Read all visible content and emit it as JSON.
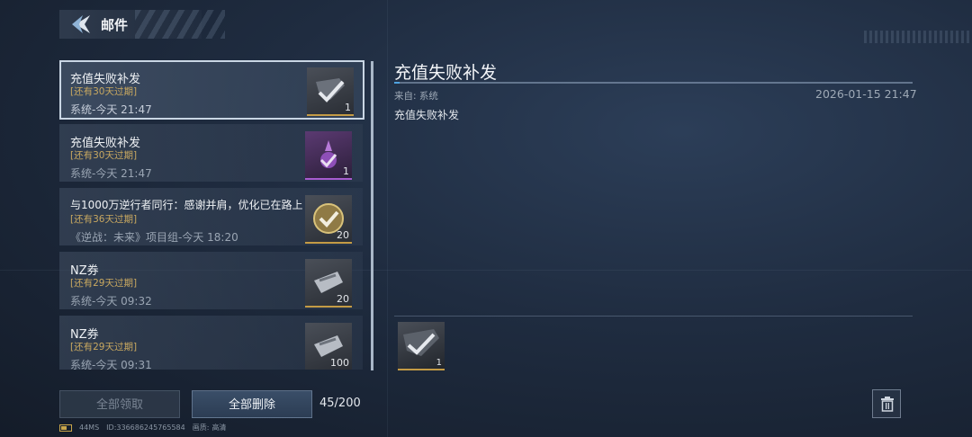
{
  "header": {
    "title": "邮件",
    "back_icon": "back-arrow-icon"
  },
  "mail_list": {
    "items": [
      {
        "subject": "充值失败补发",
        "expire": "[还有30天过期]",
        "sender": "系统-今天 21:47",
        "count": "1",
        "icon": "weapon-icon",
        "selected": true
      },
      {
        "subject": "充值失败补发",
        "expire": "[还有30天过期]",
        "sender": "系统-今天 21:47",
        "count": "1",
        "icon": "purple-item-icon",
        "selected": false
      },
      {
        "subject": "与1000万逆行者同行：感谢并肩，优化已在路上",
        "expire": "[还有36天过期]",
        "sender": "《逆战：未来》项目组-今天 18:20",
        "count": "20",
        "icon": "coin-icon",
        "selected": false
      },
      {
        "subject": "NZ券",
        "expire": "[还有29天过期]",
        "sender": "系统-今天 09:32",
        "count": "20",
        "icon": "ticket-icon",
        "selected": false
      },
      {
        "subject": "NZ券",
        "expire": "[还有29天过期]",
        "sender": "系统-今天 09:31",
        "count": "100",
        "icon": "ticket-icon",
        "selected": false
      }
    ]
  },
  "detail": {
    "title": "充值失败补发",
    "from": "来自: 系统",
    "date": "2026-01-15 21:47",
    "body": "充值失败补发",
    "attachment": {
      "count": "1",
      "icon": "weapon-icon"
    }
  },
  "footer": {
    "claim_all": "全部领取",
    "delete_all": "全部删除",
    "mail_count": "45/200",
    "trash_icon": "trash-icon"
  },
  "status": {
    "ping": "44MS",
    "id": "ID:336686245765584",
    "quality_label": "画质:",
    "quality": "高清"
  },
  "colors": {
    "expire": "#c8a860",
    "accent": "#4fa3e0",
    "rarity_gold": "#c49b45",
    "rarity_purple": "#a85cd0"
  }
}
